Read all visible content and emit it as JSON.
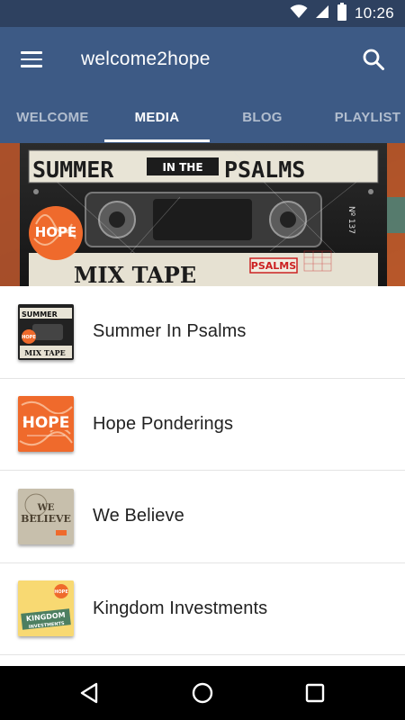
{
  "status_bar": {
    "time": "10:26",
    "icons": [
      "wifi-icon",
      "cellular-signal-icon",
      "battery-icon"
    ]
  },
  "app_bar": {
    "title": "welcome2hope",
    "left_icon": "menu-icon",
    "right_icon": "search-icon"
  },
  "tabs": [
    {
      "label": "WELCOME",
      "active": false
    },
    {
      "label": "MEDIA",
      "active": true
    },
    {
      "label": "BLOG",
      "active": false
    },
    {
      "label": "PLAYLIST",
      "active": false
    }
  ],
  "banner": {
    "title": "SUMMER IN THE PSALMS",
    "title_left": "SUMMER",
    "title_mid": "IN THE",
    "title_right": "PSALMS",
    "subtitle": "MIX TAPE",
    "badge": "HOPE",
    "label_tag": "PSALMS",
    "side_text": "Nº 137"
  },
  "media_list": [
    {
      "title": "Summer In Psalms",
      "thumb": "summer-in-psalms-thumbnail",
      "thumb_text": [
        "SUMMER",
        "HOPE",
        "MIX TAPE"
      ]
    },
    {
      "title": "Hope Ponderings",
      "thumb": "hope-ponderings-thumbnail",
      "thumb_text": [
        "HOPE"
      ]
    },
    {
      "title": "We Believe",
      "thumb": "we-believe-thumbnail",
      "thumb_text": [
        "WE",
        "BELIEVE"
      ]
    },
    {
      "title": "Kingdom Investments",
      "thumb": "kingdom-investments-thumbnail",
      "thumb_text": [
        "HOPE",
        "KINGDOM",
        "INVESTMENTS"
      ]
    }
  ],
  "nav_bar": {
    "buttons": [
      "back-icon",
      "home-icon",
      "recents-icon"
    ]
  },
  "colors": {
    "status_bar": "#2e4160",
    "app_bar": "#3d5a85",
    "hope_orange": "#ef6a2c"
  }
}
